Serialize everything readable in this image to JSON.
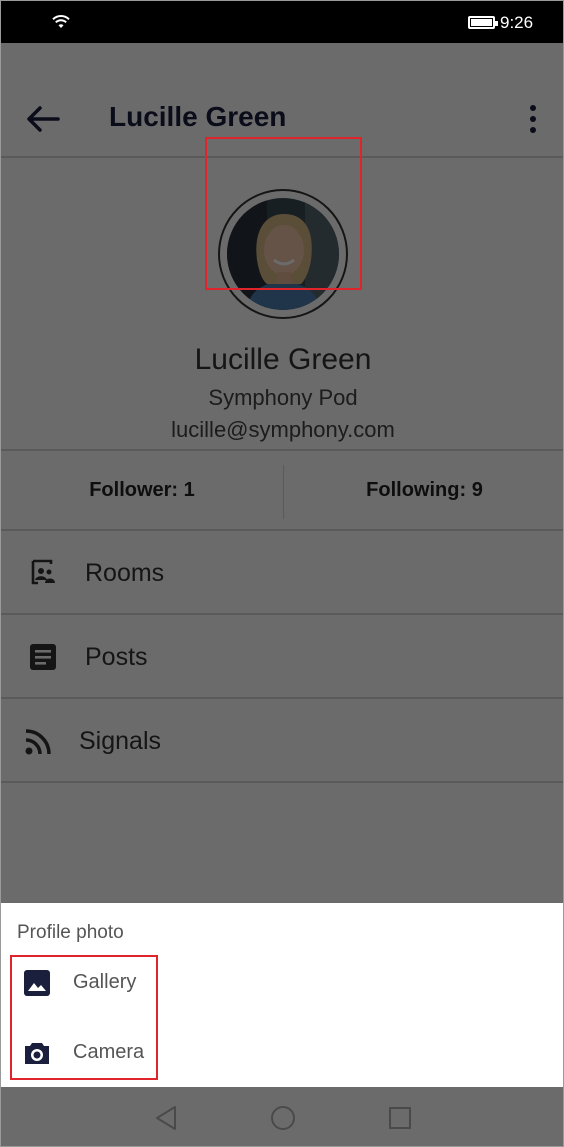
{
  "status_bar": {
    "time": "9:26",
    "wifi_icon": "wifi-icon",
    "battery_icon": "battery-icon"
  },
  "app_bar": {
    "title": "Lucille Green",
    "back_icon": "arrow-left-icon",
    "more_icon": "more-vertical-icon"
  },
  "profile": {
    "name": "Lucille Green",
    "organization": "Symphony Pod",
    "email": "lucille@symphony.com",
    "avatar": "profile-photo"
  },
  "stats": {
    "followers": "Follower: 1",
    "following": "Following: 9"
  },
  "menu": [
    {
      "label": "Rooms",
      "icon": "rooms-icon"
    },
    {
      "label": "Posts",
      "icon": "posts-icon"
    },
    {
      "label": "Signals",
      "icon": "rss-icon"
    }
  ],
  "sheet": {
    "title": "Profile photo",
    "options": [
      {
        "label": "Gallery",
        "icon": "image-icon"
      },
      {
        "label": "Camera",
        "icon": "camera-icon"
      }
    ]
  },
  "nav_bar": {
    "back_icon": "triangle-back-icon",
    "home_icon": "circle-home-icon",
    "recents_icon": "square-recents-icon"
  },
  "colors": {
    "highlight": "#e0242c",
    "icon_dark": "#1a1f3d",
    "overlay": "rgba(0,0,0,0.58)"
  }
}
